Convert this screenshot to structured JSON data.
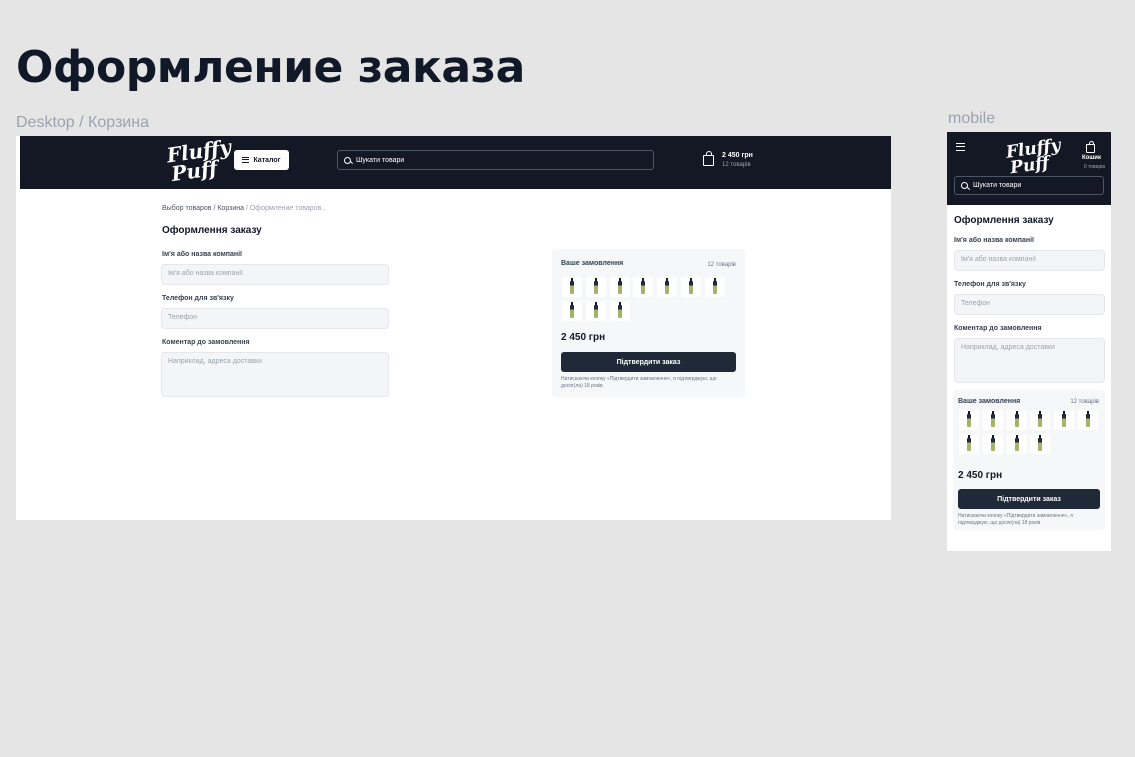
{
  "page": {
    "title": "Оформление заказа"
  },
  "frames": {
    "desktop_label": "Desktop / Корзина",
    "mobile_label": "mobile"
  },
  "header": {
    "logo": {
      "line1": "Fluffy",
      "line2": "Puff"
    },
    "catalog_label": "Каталог",
    "search_placeholder": "Шукати товари",
    "cart_total": "2 450 грн",
    "cart_count": "12 товарів"
  },
  "breadcrumb": {
    "crumb1": "Выбор товаров",
    "sep1": " / ",
    "crumb2": "Корзина",
    "sep2": " / ",
    "current": "Оформление товаров.."
  },
  "form": {
    "title": "Оформлення заказу",
    "name_label": "Ім'я або назва компанії",
    "name_placeholder": "Ім'я або назва компанії",
    "phone_label": "Телефон для зв'язку",
    "phone_placeholder": "Телефон",
    "comment_label": "Коментар до замовлення",
    "comment_placeholder": "Наприклад, адреса доставки"
  },
  "order": {
    "title": "Ваше замовлення",
    "count": "12 товарів",
    "items_shown": 10,
    "total": "2 450 грн",
    "confirm_label": "Підтвердити заказ",
    "note": "Натискаючи кнопку «Підтвердити замовлення», я підтверджую, що досяг(ла) 18 років"
  },
  "mobile": {
    "cart_label": "Кошик",
    "cart_count": "0 товарів"
  },
  "colors": {
    "header_bg": "#141824",
    "button_bg": "#1f2937",
    "page_bg": "#e5e5e5",
    "input_bg": "#f3f5f8"
  }
}
